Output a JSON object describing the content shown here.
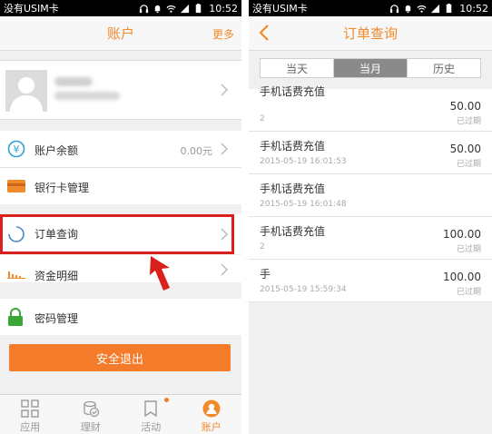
{
  "left": {
    "status": {
      "carrier": "没有USIM卡",
      "time": "10:52"
    },
    "header": {
      "title": "账户",
      "more": "更多"
    },
    "menu": {
      "balance": {
        "label": "账户余额",
        "value": "0.00元"
      },
      "bank": {
        "label": "银行卡管理"
      },
      "orders": {
        "label": "订单查询"
      },
      "assets": {
        "label": "资金明细"
      },
      "password": {
        "label": "密码管理"
      }
    },
    "logout": "安全退出",
    "tabs": [
      {
        "label": "应用",
        "icon": "grid-icon"
      },
      {
        "label": "理财",
        "icon": "coin-stack-icon"
      },
      {
        "label": "活动",
        "icon": "bookmark-icon"
      },
      {
        "label": "账户",
        "icon": "person-icon"
      }
    ]
  },
  "right": {
    "status": {
      "carrier": "没有USIM卡",
      "time": "10:52"
    },
    "header": {
      "title": "订单查询"
    },
    "segments": [
      "当天",
      "当月",
      "历史"
    ],
    "active_segment": "当月",
    "orders": [
      {
        "name": "手机话费充值",
        "time": "2",
        "amount": "50.00",
        "status": "已过期"
      },
      {
        "name": "手机话费充值",
        "time": "2015-05-19 16:01:53",
        "amount": "50.00",
        "status": "已过期"
      },
      {
        "name": "手机话费充值",
        "time": "2015-05-19 16:01:48",
        "amount": "",
        "status": ""
      },
      {
        "name": "手机话费充值",
        "time": "2",
        "amount": "100.00",
        "status": "已过期"
      },
      {
        "name": "手",
        "time": "2015-05-19 15:59:34",
        "amount": "100.00",
        "status": "已过期"
      }
    ]
  },
  "colors": {
    "accent": "#f08a2b",
    "button": "#f47b2a",
    "highlight": "#d9201c",
    "lock": "#3aa636",
    "yen": "#2f9fd8"
  }
}
